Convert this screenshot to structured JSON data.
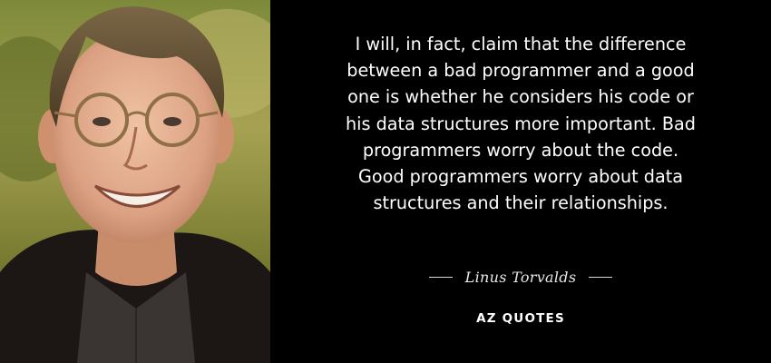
{
  "quote": {
    "lines": [
      "I will, in fact, claim that the difference",
      "between a bad programmer and a good",
      "one is whether he considers his code or",
      "his data structures more important. Bad",
      "programmers worry about the code.",
      "Good programmers worry about data",
      "structures and their relationships."
    ],
    "author": "Linus Torvalds"
  },
  "brand": "AZ QUOTES",
  "colors": {
    "background": "#000000",
    "quote_text": "#ffffff",
    "author_text": "#e8e8e8"
  },
  "photo": {
    "icon": "author-portrait"
  }
}
